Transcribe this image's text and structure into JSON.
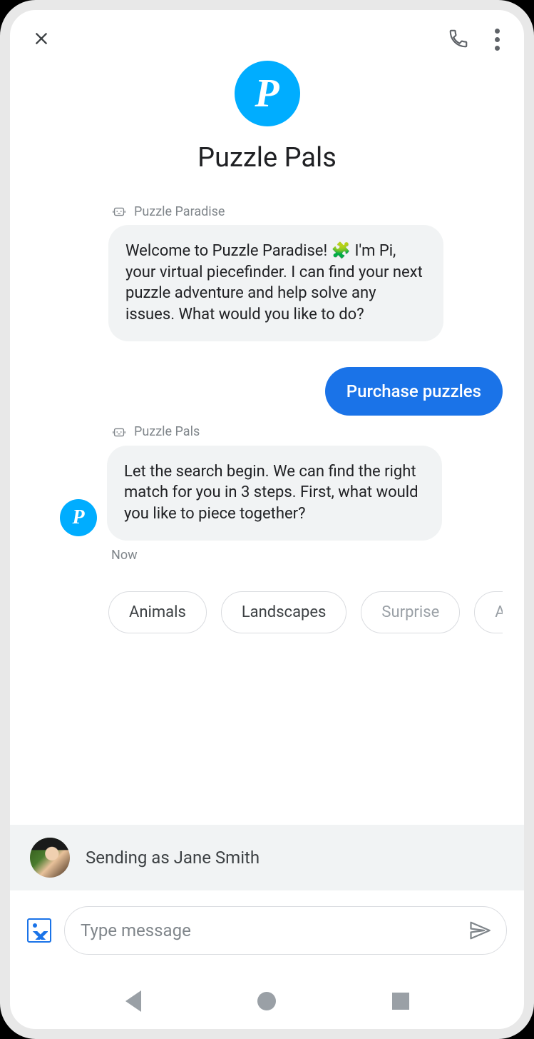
{
  "header": {
    "avatar_letter": "P",
    "title": "Puzzle Pals"
  },
  "messages": [
    {
      "sender_label": "Puzzle Paradise",
      "text": "Welcome to Puzzle Paradise! 🧩 I'm Pi, your virtual piecefinder. I can find your next puzzle adventure and help solve any issues. What would you like to do?"
    },
    {
      "outgoing_text": "Purchase puzzles"
    },
    {
      "sender_label": "Puzzle Pals",
      "avatar_letter": "P",
      "text": "Let the search begin. We can find the right match for you in 3 steps. First, what would you like to piece together?",
      "timestamp": "Now"
    }
  ],
  "chips": [
    {
      "label": "Animals"
    },
    {
      "label": "Landscapes"
    },
    {
      "label": "Surprise"
    },
    {
      "label": "A"
    }
  ],
  "sending_as": {
    "text": "Sending as Jane Smith"
  },
  "compose": {
    "placeholder": "Type message"
  },
  "colors": {
    "brand_blue": "#1a73e8",
    "avatar_cyan": "#00adff",
    "bubble_grey": "#f1f3f4"
  }
}
